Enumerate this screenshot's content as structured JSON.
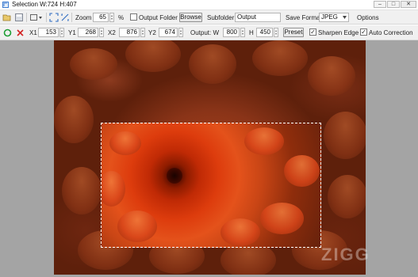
{
  "window": {
    "title": "Selection  W:724 H:407",
    "btn_min": "–",
    "btn_max": "□",
    "btn_close": "✕"
  },
  "toolbar1": {
    "zoom_label": "Zoom",
    "zoom_value": "65",
    "zoom_unit": "%",
    "output_folder_label": "Output Folder",
    "output_folder_checked": false,
    "browse_label": "Browse",
    "subfolder_label": "Subfolder",
    "subfolder_value": "Output",
    "save_format_label": "Save Format",
    "save_format_value": "JPEG",
    "options_label": "Options"
  },
  "toolbar2": {
    "x1_label": "X1",
    "x1_value": "153",
    "y1_label": "Y1",
    "y1_value": "268",
    "x2_label": "X2",
    "x2_value": "876",
    "y2_label": "Y2",
    "y2_value": "674",
    "output_label": "Output: W",
    "output_w_value": "800",
    "h_label": "H",
    "output_h_value": "450",
    "preset_label": "Preset",
    "sharpen_label": "Sharpen Edge",
    "sharpen_checked": true,
    "auto_label": "Auto Correction",
    "auto_checked": true
  },
  "watermark": "ZIGG",
  "colors": {
    "accept": "#1e9e35",
    "cancel": "#d22424",
    "toolbar_bg": "#f0f0f0",
    "canvas_bg": "#a4a4a4"
  },
  "icons": [
    "app-icon",
    "open-icon",
    "save-icon",
    "crop-shape-icon",
    "fit-screen-icon",
    "actual-size-icon",
    "accept-icon",
    "cancel-icon"
  ]
}
